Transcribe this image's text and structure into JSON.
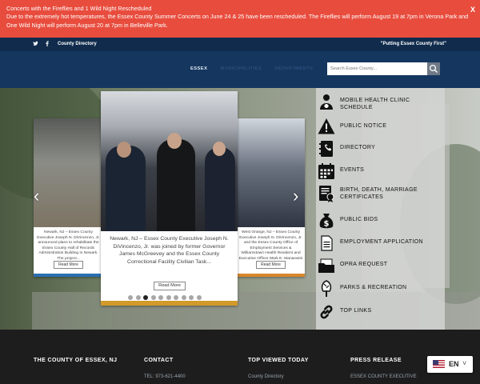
{
  "alert": {
    "title": "Concerts with the Fireflies and 1 Wild Night Rescheduled",
    "message": "Due to the extremely hot temperatures, the Essex County Summer Concerts on June 24 & 25 have been rescheduled. The Fireflies will perform August 19 at 7pm in Verona Park and One Wild Night will perform August 20 at 7pm in Belleville Park.",
    "close": "X",
    "color": "#e84c3d"
  },
  "topbar": {
    "twitter_icon": "twitter-icon",
    "facebook_icon": "facebook-icon",
    "directory": "County Directory",
    "slogan": "\"Putting Essex County First\""
  },
  "nav": {
    "items": [
      "ESSEX",
      "MUNICIPALITIES",
      "DEPARTMENTS"
    ],
    "active": "ESSEX",
    "search_placeholder": "Search Essex County..."
  },
  "slider": {
    "left_caption": "Newark, NJ – Essex County Executive Joseph N. DiVincenzo, Jr. announced plans to rehabilitate the Essex County Hall of Records Administration Building in Newark. The project...",
    "main_caption": "Newark, NJ – Essex County Executive Joseph N. DiVincenzo, Jr. was joined by former Governor James McGreevey and the Essex County Correctional Facility Civilian Task...",
    "right_caption": "West Orange, NJ – Essex County Executive Joseph N. DiVincenzo, Jr. and the Essex County Office of Employment Services & Williamstown Health Resident and Executive Officer Mark E. Manaswini announced a...",
    "read_more": "Read More",
    "dot_count": 10,
    "active_dot": 2,
    "prev_icon": "chevron-left-icon",
    "next_icon": "chevron-right-icon"
  },
  "quick_links": [
    {
      "label": "MOBILE HEALTH CLINIC SCHEDULE",
      "icon": "doctor-icon"
    },
    {
      "label": "PUBLIC NOTICE",
      "icon": "warning-icon"
    },
    {
      "label": "DIRECTORY",
      "icon": "directory-book-icon"
    },
    {
      "label": "EVENTS",
      "icon": "calendar-icon"
    },
    {
      "label": "BIRTH, DEATH, MARRIAGE CERTIFICATES",
      "icon": "certificate-icon"
    },
    {
      "label": "PUBLIC BIDS",
      "icon": "money-bag-icon"
    },
    {
      "label": "EMPLOYMENT APPLICATION",
      "icon": "document-icon"
    },
    {
      "label": "OPRA REQUEST",
      "icon": "folder-icon"
    },
    {
      "label": "PARKS & RECREATION",
      "icon": "tree-icon"
    },
    {
      "label": "TOP LINKS",
      "icon": "link-icon"
    }
  ],
  "footer": {
    "col1_title": "THE COUNTY OF ESSEX, NJ",
    "col2_title": "CONTACT",
    "col3_title": "TOP VIEWED TODAY",
    "col4_title": "PRESS RELEASE",
    "phone": "TEL: 973-621-4400",
    "top_link": "County Directory",
    "press_link": "ESSEX COUNTY EXECUTIVE"
  },
  "language": {
    "code": "EN",
    "flag_icon": "us-flag-icon"
  }
}
